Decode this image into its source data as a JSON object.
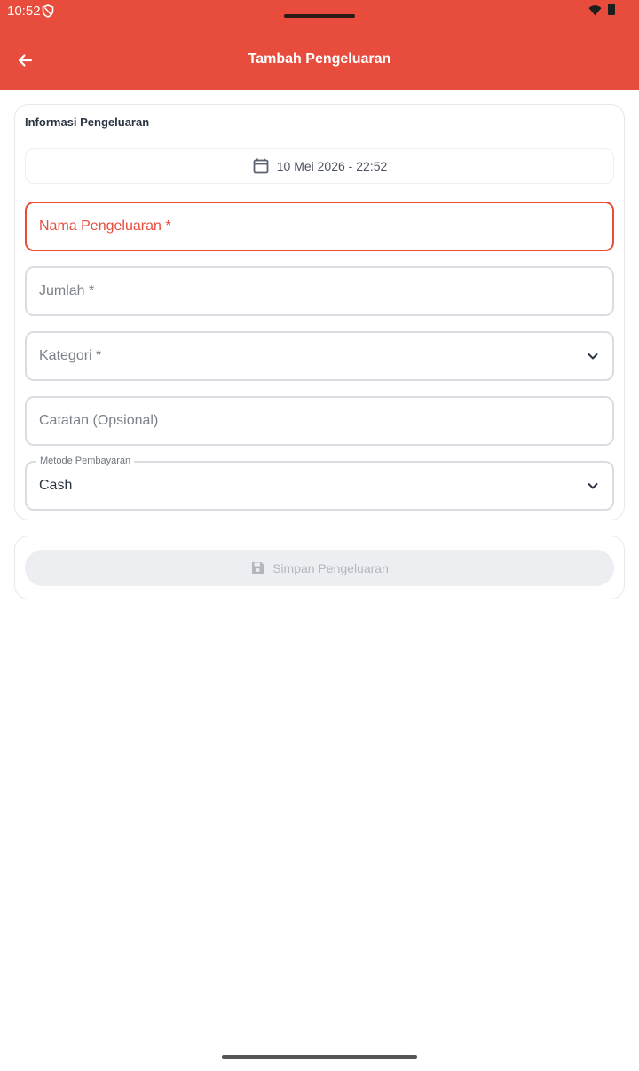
{
  "status_bar": {
    "time": "10:52"
  },
  "app_bar": {
    "title": "Tambah Pengeluaran",
    "back_icon": "arrow-left-icon"
  },
  "form": {
    "section_title": "Informasi Pengeluaran",
    "date_icon": "calendar-icon",
    "date_value": "10 Mei 2026 - 22:52",
    "name_placeholder": "Nama Pengeluaran *",
    "amount_placeholder": "Jumlah *",
    "category_placeholder": "Kategori *",
    "note_placeholder": "Catatan (Opsional)",
    "payment_label": "Metode Pembayaran",
    "payment_value": "Cash"
  },
  "actions": {
    "save_label": "Simpan Pengeluaran",
    "save_icon": "floppy-disk-icon"
  },
  "colors": {
    "primary": "#e74c3c",
    "error": "#e74c3c",
    "text_dark": "#2b3442",
    "disabled_bg": "#eceef1",
    "disabled_text": "#b3b7bd"
  }
}
